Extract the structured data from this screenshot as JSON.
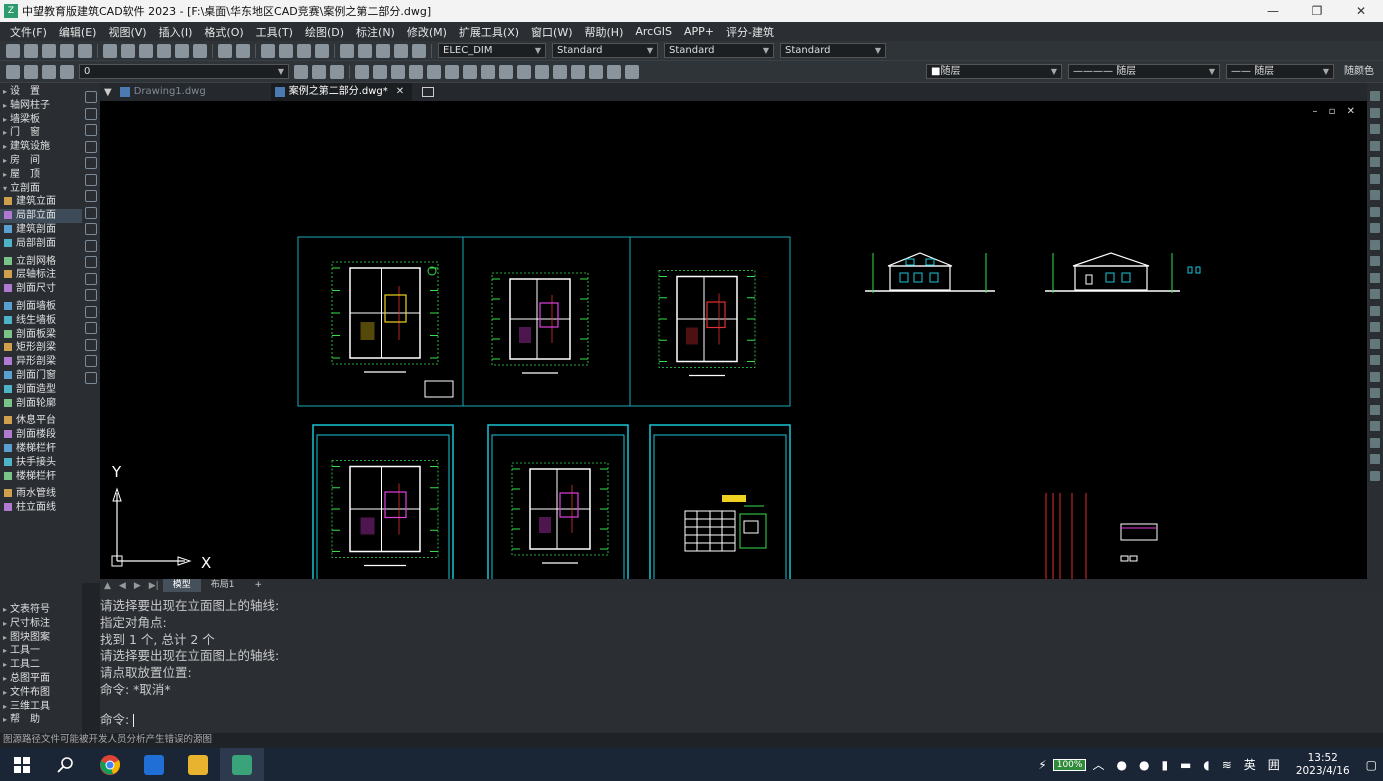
{
  "window": {
    "title": "中望教育版建筑CAD软件 2023 - [F:\\桌面\\华东地区CAD竞赛\\案例之第二部分.dwg]",
    "minimize": "—",
    "restore": "❐",
    "close": "✕"
  },
  "menu": [
    "文件(F)",
    "编辑(E)",
    "视图(V)",
    "插入(I)",
    "格式(O)",
    "工具(T)",
    "绘图(D)",
    "标注(N)",
    "修改(M)",
    "扩展工具(X)",
    "窗口(W)",
    "帮助(H)",
    "ArcGIS",
    "APP+",
    "评分-建筑"
  ],
  "toolbar1": {
    "dimstyle": "ELEC_DIM",
    "textstyle": "Standard",
    "tablestyle": "Standard",
    "mleaderstyle": "Standard"
  },
  "toolbar2": {
    "layer": "0",
    "color": "随层",
    "linetype": "随层",
    "lineweight": "随层",
    "plotstyle": "随颜色"
  },
  "left_panel": {
    "top_items": [
      {
        "label": "设　置",
        "type": "caret"
      },
      {
        "label": "轴网柱子",
        "type": "caret"
      },
      {
        "label": "墙梁板",
        "type": "caret"
      },
      {
        "label": "门　窗",
        "type": "caret"
      },
      {
        "label": "建筑设施",
        "type": "caret"
      },
      {
        "label": "房　间",
        "type": "caret"
      },
      {
        "label": "屋　顶",
        "type": "caret"
      },
      {
        "label": "立剖面",
        "type": "open"
      },
      {
        "label": "建筑立面",
        "type": "icon"
      },
      {
        "label": "局部立面",
        "type": "icon"
      },
      {
        "label": "建筑剖面",
        "type": "icon"
      },
      {
        "label": "局部剖面",
        "type": "icon"
      },
      {
        "label": "立剖网格",
        "type": "icon"
      },
      {
        "label": "层轴标注",
        "type": "icon"
      },
      {
        "label": "剖面尺寸",
        "type": "icon"
      },
      {
        "label": "剖面墙板",
        "type": "icon"
      },
      {
        "label": "线生墙板",
        "type": "icon"
      },
      {
        "label": "剖面板梁",
        "type": "icon"
      },
      {
        "label": "矩形剖梁",
        "type": "icon"
      },
      {
        "label": "异形剖梁",
        "type": "icon"
      },
      {
        "label": "剖面门窗",
        "type": "icon"
      },
      {
        "label": "剖面造型",
        "type": "icon"
      },
      {
        "label": "剖面轮廓",
        "type": "icon"
      },
      {
        "label": "休息平台",
        "type": "icon"
      },
      {
        "label": "剖面楼段",
        "type": "icon"
      },
      {
        "label": "楼梯栏杆",
        "type": "icon"
      },
      {
        "label": "扶手接头",
        "type": "icon"
      },
      {
        "label": "楼梯栏杆",
        "type": "icon"
      },
      {
        "label": "雨水管线",
        "type": "icon"
      },
      {
        "label": "柱立面线",
        "type": "icon"
      }
    ],
    "bottom_items": [
      "文表符号",
      "尺寸标注",
      "图块图案",
      "工具一",
      "工具二",
      "总图平面",
      "文件布图",
      "三维工具",
      "帮　助"
    ]
  },
  "doc_tabs": [
    {
      "label": "Drawing1.dwg",
      "active": false
    },
    {
      "label": "案例之第二部分.dwg*",
      "active": true
    }
  ],
  "canvas": {
    "ucs_y": "Y",
    "ucs_x": "X",
    "viewport_controls": "– ▫ ✕"
  },
  "layout_tabs": [
    "模型",
    "布局1",
    "+"
  ],
  "command_history": [
    "请选择要出现在立面图上的轴线:",
    "指定对角点:",
    "找到 1 个, 总计 2 个",
    "请选择要出现在立面图上的轴线:",
    "请点取放置位置:",
    "命令: *取消*"
  ],
  "command_prompt": "命令:",
  "status_text": "图源路径文件可能被开发人员分析产生错误的源图",
  "taskbar": {
    "battery": "100%",
    "ime_lang": "英",
    "ime_mode": "囲",
    "time": "13:52",
    "date": "2023/4/16"
  },
  "colors": {
    "accent_cyan": "#17c6d6",
    "canvas_bg": "#000000",
    "wall_white": "#ffffff",
    "dim_green": "#35e04a",
    "red_line": "#e03030",
    "magenta": "#e040e0",
    "yellow": "#f0d020"
  }
}
